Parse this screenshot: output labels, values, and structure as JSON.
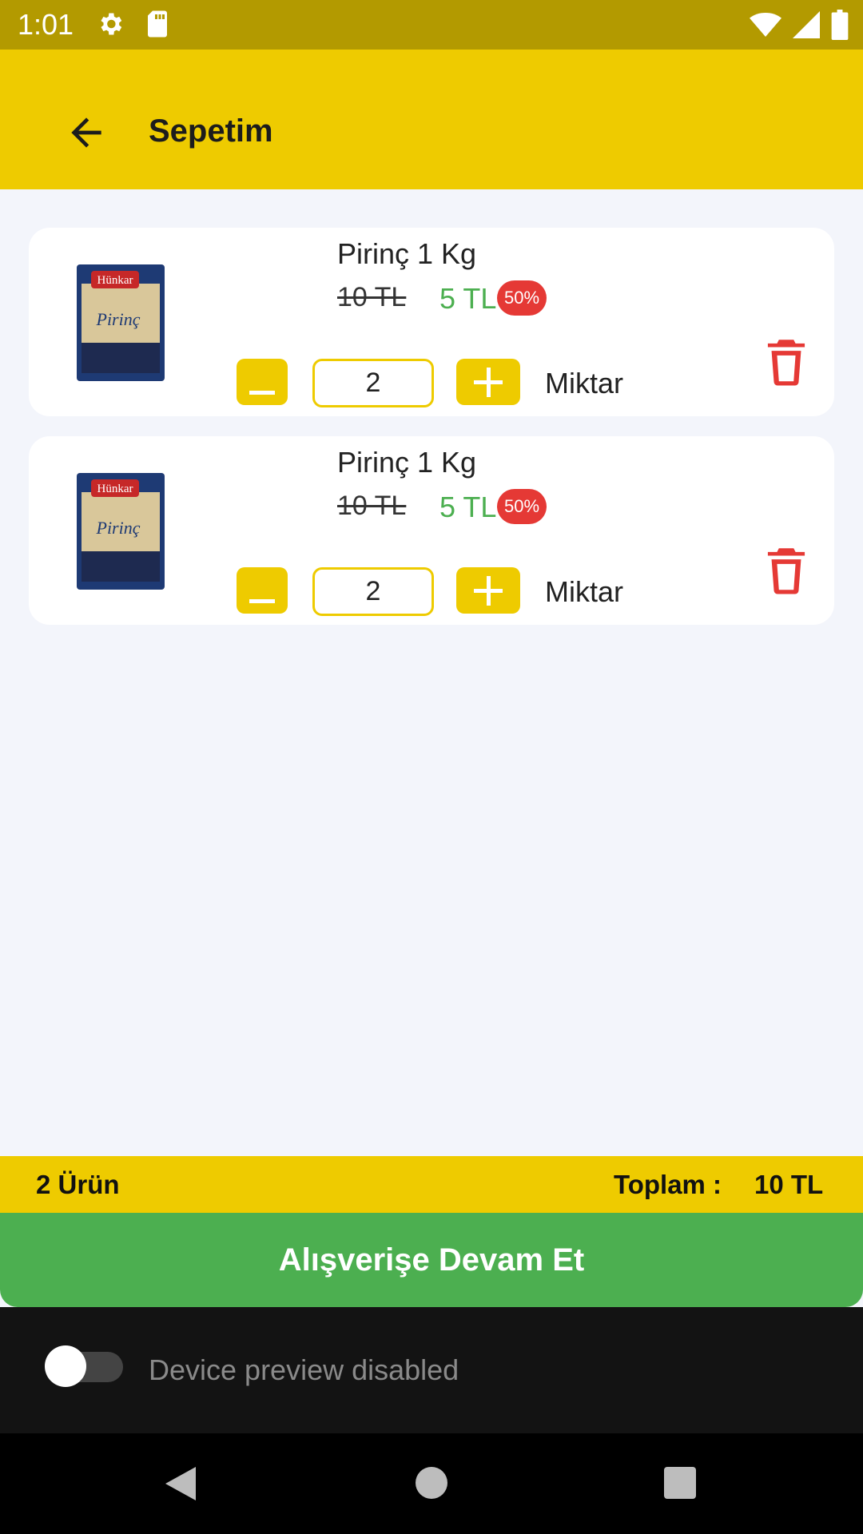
{
  "status_bar": {
    "time": "1:01",
    "icons": [
      "settings-icon",
      "sd-card-icon",
      "wifi-icon",
      "signal-icon",
      "battery-icon"
    ]
  },
  "app_bar": {
    "title": "Sepetim",
    "back_icon": "arrow-left-icon"
  },
  "cart": {
    "items": [
      {
        "name": "Pirinç 1 Kg",
        "old_price": "10 TL",
        "new_price": "5 TL",
        "discount": "50%",
        "quantity": "2",
        "quantity_label": "Miktar",
        "image_brand": "Hünkar",
        "image_label": "Pirinç"
      },
      {
        "name": "Pirinç 1 Kg",
        "old_price": "10 TL",
        "new_price": "5 TL",
        "discount": "50%",
        "quantity": "2",
        "quantity_label": "Miktar",
        "image_brand": "Hünkar",
        "image_label": "Pirinç"
      }
    ]
  },
  "summary": {
    "item_count": "2 Ürün",
    "total_label": "Toplam :",
    "total_value": "10 TL"
  },
  "continue_button": {
    "label": "Alışverişe Devam Et"
  },
  "device_preview": {
    "label": "Device preview disabled",
    "enabled": false
  },
  "colors": {
    "status_bar": "#b39a00",
    "accent": "#eecb00",
    "green": "#4caf50",
    "red": "#e53935",
    "background": "#f3f5fb"
  }
}
